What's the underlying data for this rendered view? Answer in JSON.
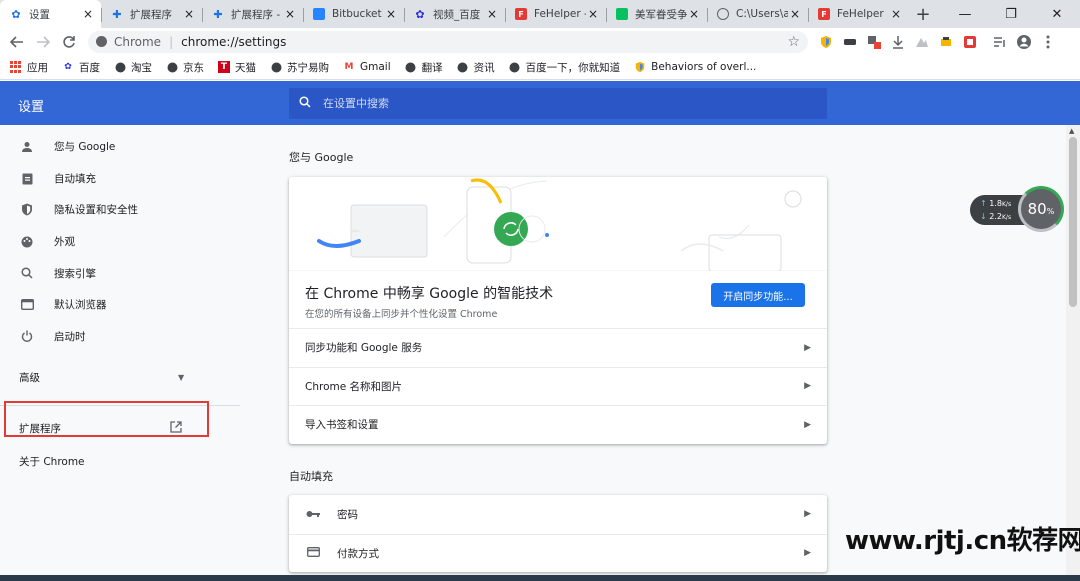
{
  "tabs": [
    {
      "title": "设置",
      "favicon": "gear-icon",
      "color": "#1a73e8"
    },
    {
      "title": "扩展程序",
      "favicon": "puzzle-icon",
      "color": "#1a73e8"
    },
    {
      "title": "扩展程序 -",
      "favicon": "puzzle-icon",
      "color": "#1a73e8"
    },
    {
      "title": "Bitbucket |",
      "favicon": "bitbucket-icon",
      "color": "#2684ff"
    },
    {
      "title": "视频_百度",
      "favicon": "baidu-icon",
      "color": "#2932e1"
    },
    {
      "title": "FeHelper -",
      "favicon": "fehelper-icon",
      "color": "#e53935"
    },
    {
      "title": "美军眷受争",
      "favicon": "wechat-icon",
      "color": "#07c160"
    },
    {
      "title": "C:\\Users\\a",
      "favicon": "globe-icon",
      "color": "#5f6368"
    },
    {
      "title": "FeHelper",
      "favicon": "fehelper-icon",
      "color": "#e53935"
    }
  ],
  "tab_close_glyph": "×",
  "new_tab_glyph": "+",
  "window": {
    "minimize": "—",
    "maximize": "❐",
    "close": "✕"
  },
  "omnibox": {
    "scheme": "Chrome",
    "url": "chrome://settings"
  },
  "bookmarks": [
    {
      "label": "应用",
      "icon": "apps-grid-icon"
    },
    {
      "label": "百度",
      "icon": "baidu-icon"
    },
    {
      "label": "淘宝",
      "icon": "globe-icon"
    },
    {
      "label": "京东",
      "icon": "globe-icon"
    },
    {
      "label": "天猫",
      "icon": "tmall-icon"
    },
    {
      "label": "苏宁易购",
      "icon": "globe-icon"
    },
    {
      "label": "Gmail",
      "icon": "gmail-icon"
    },
    {
      "label": "翻译",
      "icon": "globe-icon"
    },
    {
      "label": "资讯",
      "icon": "globe-icon"
    },
    {
      "label": "百度一下，你就知道",
      "icon": "globe-icon"
    },
    {
      "label": "Behaviors of overl...",
      "icon": "shield-icon"
    }
  ],
  "settings": {
    "title": "设置",
    "search_placeholder": "在设置中搜索"
  },
  "sidebar": {
    "items": [
      {
        "label": "您与 Google",
        "icon": "person-icon"
      },
      {
        "label": "自动填充",
        "icon": "clipboard-icon"
      },
      {
        "label": "隐私设置和安全性",
        "icon": "shield-icon"
      },
      {
        "label": "外观",
        "icon": "palette-icon"
      },
      {
        "label": "搜索引擎",
        "icon": "search-icon"
      },
      {
        "label": "默认浏览器",
        "icon": "browser-icon"
      },
      {
        "label": "启动时",
        "icon": "power-icon"
      }
    ],
    "advanced": "高级",
    "extensions": "扩展程序",
    "about": "关于 Chrome"
  },
  "main": {
    "you_and_google": "您与 Google",
    "promo_title": "在 Chrome 中畅享 Google 的智能技术",
    "promo_subtitle": "在您的所有设备上同步并个性化设置 Chrome",
    "sync_button": "开启同步功能...",
    "rows": [
      "同步功能和 Google 服务",
      "Chrome 名称和图片",
      "导入书签和设置"
    ],
    "autofill_title": "自动填充",
    "autofill_rows": [
      {
        "label": "密码",
        "icon": "key-icon"
      },
      {
        "label": "付款方式",
        "icon": "card-icon"
      }
    ]
  },
  "speed_widget": {
    "upload": "1.8",
    "download": "2.2",
    "unit": "K/s",
    "percent": "80",
    "percent_sign": "%"
  },
  "watermark": "www.rjtj.cn软荐网"
}
